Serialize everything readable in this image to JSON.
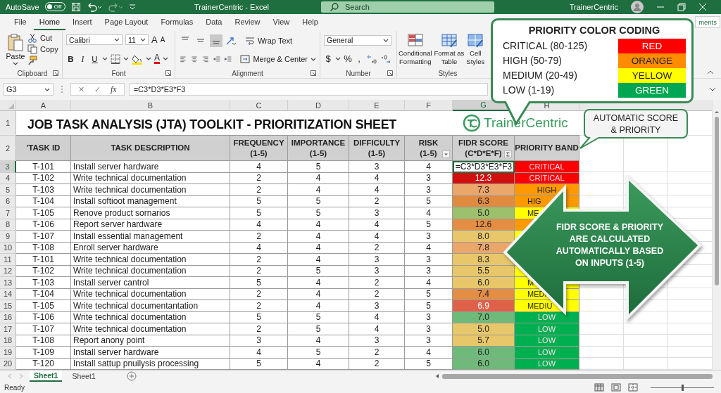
{
  "title_bar": {
    "autosave_label": "AutoSave",
    "autosave": {
      "label": "Off",
      "on": false
    },
    "redo": {
      "disabled": true
    },
    "title": "TrainerCentric - Excel",
    "search": {
      "placeholder": "Search"
    },
    "user": "TrainerCentric"
  },
  "ribbon_tabs": [
    {
      "label": "File",
      "selected": false
    },
    {
      "label": "Home",
      "selected": true
    },
    {
      "label": "Insert",
      "selected": false
    },
    {
      "label": "Page Layout",
      "selected": false
    },
    {
      "label": "Formulas",
      "selected": false
    },
    {
      "label": "Data",
      "selected": false
    },
    {
      "label": "Review",
      "selected": false
    },
    {
      "label": "View",
      "selected": false
    },
    {
      "label": "Help",
      "selected": false
    }
  ],
  "comments_button": "ments",
  "ribbon": {
    "clipboard": {
      "paste": "Paste",
      "cut": "Cut",
      "copy": "Copy",
      "label": "Clipboard"
    },
    "font": {
      "name": "Calibri",
      "size": "11",
      "grow": "A",
      "shrink": "A",
      "format_buttons": [
        "B",
        "I",
        "U"
      ],
      "font_color": "A",
      "label": "Font"
    },
    "alignment": {
      "vertical": [
        {
          "kind": "top",
          "selected": false
        },
        {
          "kind": "middle",
          "selected": false
        },
        {
          "kind": "bottom",
          "selected": true
        }
      ],
      "wrap": "Wrap Text",
      "merge": "Merge & Center",
      "label": "Alignment"
    },
    "number": {
      "format": "General",
      "symbols": [
        "$",
        "%",
        ","
      ],
      "label": "Number"
    },
    "styles": {
      "items": [
        {
          "kind": "conditional",
          "label": "Conditional\nFormatting"
        },
        {
          "kind": "table",
          "label": "Format as\nTable"
        },
        {
          "kind": "cell",
          "label": "Cell\nStyles"
        }
      ],
      "label": "Styles"
    }
  },
  "formula_bar": {
    "name_box": "G3",
    "cancel": "✕",
    "enter": "✓",
    "function": "fx",
    "formula": "=C3*D3*E3*F3"
  },
  "sheet": {
    "columns": [
      {
        "letter": "A",
        "selected": false
      },
      {
        "letter": "B",
        "selected": false
      },
      {
        "letter": "C",
        "selected": false
      },
      {
        "letter": "D",
        "selected": false
      },
      {
        "letter": "E",
        "selected": false
      },
      {
        "letter": "F",
        "selected": false
      },
      {
        "letter": "G",
        "selected": true
      },
      {
        "letter": "H",
        "selected": false
      }
    ],
    "title_row_num": "1",
    "title": "JOB TASK ANALYSIS (JTA) TOOLKIT - PRIORITIZATION SHEET",
    "logo": "TrainerCentric",
    "header_row_num": "2",
    "headers": [
      {
        "label": "'TASK ID",
        "kind": "plain"
      },
      {
        "label": "TASK DESCRIPTION",
        "kind": "plain"
      },
      {
        "label": "FREQUENCY\n(1-5)",
        "kind": "plain"
      },
      {
        "label": "IMPORTANCE\n(1-5)",
        "kind": "plain"
      },
      {
        "label": "DIFFICULTY\n(1-5)",
        "kind": "plain"
      },
      {
        "label": "RISK\n(1-5)",
        "kind": "filter"
      },
      {
        "label": "FIDR SCORE\n(C*D*E*F)",
        "kind": "sum"
      },
      {
        "label": "PRIORITY BAND",
        "kind": "plain"
      }
    ],
    "rows": [
      {
        "num": "3",
        "selected": true,
        "id": "T-101",
        "task": "Install server hardware",
        "values": [
          "4",
          "5",
          "3",
          "4"
        ],
        "score": {
          "text": "=C3*D3*E3*F3",
          "editing": true
        },
        "band": {
          "text": "CRITICAL",
          "color": "#ff0000",
          "cut": false
        }
      },
      {
        "num": "4",
        "selected": false,
        "id": "T-102",
        "task": "Write technical documentation",
        "values": [
          "2",
          "4",
          "4",
          "3"
        ],
        "score": {
          "text": "12.3",
          "color": "#d20f0f",
          "editing": false
        },
        "band": {
          "text": "CRITICAL",
          "color": "#ff0000",
          "cut": false
        }
      },
      {
        "num": "5",
        "selected": false,
        "id": "T-103",
        "task": "Write technical documentation",
        "values": [
          "2",
          "4",
          "4",
          "3"
        ],
        "score": {
          "text": "7.3",
          "color": "#eba66a",
          "editing": false
        },
        "band": {
          "text": "HIGH",
          "color": "#ff9900",
          "cut": false
        }
      },
      {
        "num": "6",
        "selected": false,
        "id": "T-104",
        "task": "Install softioot management",
        "values": [
          "5",
          "5",
          "2",
          "5"
        ],
        "score": {
          "text": "6.3",
          "color": "#e08b3f",
          "editing": false
        },
        "band": {
          "text": "HIG",
          "color": "#ff9900",
          "cut": true
        }
      },
      {
        "num": "7",
        "selected": false,
        "id": "T-105",
        "task": "Renove product sornarios",
        "values": [
          "5",
          "5",
          "3",
          "4"
        ],
        "score": {
          "text": "5.0",
          "color": "#9dc06c",
          "editing": false
        },
        "band": {
          "text": "ME",
          "color": "#ffff00",
          "cut": true
        }
      },
      {
        "num": "8",
        "selected": false,
        "id": "T-106",
        "task": "Report server hardware",
        "values": [
          "4",
          "4",
          "4",
          "5"
        ],
        "score": {
          "text": "12.6",
          "color": "#e48e45",
          "editing": false
        },
        "band": {
          "color": "#ff9900"
        }
      },
      {
        "num": "9",
        "selected": false,
        "id": "T-107",
        "task": "Install essential management",
        "values": [
          "2",
          "4",
          "4",
          "3"
        ],
        "score": {
          "text": "8.0",
          "color": "#e7c76a",
          "editing": false
        },
        "band": {
          "color": "#ffff00"
        }
      },
      {
        "num": "10",
        "selected": false,
        "id": "T-108",
        "task": "Enroll server hardware",
        "values": [
          "4",
          "4",
          "2",
          "4"
        ],
        "score": {
          "text": "7.8",
          "color": "#eba66a",
          "editing": false
        }
      },
      {
        "num": "11",
        "selected": false,
        "id": "T-101",
        "task": "Write technical documentation",
        "values": [
          "2",
          "4",
          "3",
          "3"
        ],
        "score": {
          "text": "8.3",
          "color": "#e7c76a",
          "editing": false
        }
      },
      {
        "num": "12",
        "selected": false,
        "id": "T-102",
        "task": "Write technical documentation",
        "values": [
          "2",
          "5",
          "3",
          "3"
        ],
        "score": {
          "text": "5.5",
          "color": "#e7c76a",
          "editing": false
        },
        "band": {
          "color": "#ffff00"
        }
      },
      {
        "num": "13",
        "selected": false,
        "id": "T-103",
        "task": "Install server cantrol",
        "values": [
          "5",
          "4",
          "2",
          "4"
        ],
        "score": {
          "text": "6.0",
          "color": "#e7c76a",
          "editing": false
        },
        "band": {
          "text": "M",
          "color": "#ffff00",
          "cut": true
        }
      },
      {
        "num": "14",
        "selected": false,
        "id": "T-104",
        "task": "Write technical documentation",
        "values": [
          "2",
          "4",
          "2",
          "5"
        ],
        "score": {
          "text": "7.4",
          "color": "#e48e45",
          "editing": false
        },
        "band": {
          "text": "MEDI",
          "color": "#ffff00",
          "cut": true
        }
      },
      {
        "num": "15",
        "selected": false,
        "id": "T-105",
        "task": "Write technical documentantation",
        "values": [
          "2",
          "4",
          "3",
          "5"
        ],
        "score": {
          "text": "6.9",
          "color": "#e0614a",
          "editing": false
        },
        "band": {
          "text": "MEDIU",
          "color": "#ffff00",
          "cut": true
        }
      },
      {
        "num": "16",
        "selected": false,
        "id": "T-106",
        "task": "Write technical documentation",
        "values": [
          "5",
          "5",
          "4",
          "3"
        ],
        "score": {
          "text": "7.0",
          "color": "#6fba7a",
          "editing": false
        },
        "band": {
          "text": "LOW",
          "color": "#00b050",
          "cut": false
        }
      },
      {
        "num": "17",
        "selected": false,
        "id": "T-107",
        "task": "Write technical documentation",
        "values": [
          "2",
          "5",
          "4",
          "3"
        ],
        "score": {
          "text": "5.0",
          "color": "#e7c76a",
          "editing": false
        },
        "band": {
          "text": "LOW",
          "color": "#00b050",
          "cut": false
        }
      },
      {
        "num": "18",
        "selected": false,
        "id": "T-108",
        "task": "Report anony point",
        "values": [
          "3",
          "4",
          "3",
          "3"
        ],
        "score": {
          "text": "5.7",
          "color": "#e7c76a",
          "editing": false
        },
        "band": {
          "text": "LOW",
          "color": "#00b050",
          "cut": false
        }
      },
      {
        "num": "19",
        "selected": false,
        "id": "T-109",
        "task": "Install server hardware",
        "values": [
          "4",
          "5",
          "2",
          "4"
        ],
        "score": {
          "text": "6.0",
          "color": "#6fba7a",
          "editing": false
        },
        "band": {
          "text": "LOW",
          "color": "#00b050",
          "cut": false
        }
      },
      {
        "num": "20",
        "selected": false,
        "id": "T-120",
        "task": "Install sattup pnuilysis processing",
        "values": [
          "5",
          "4",
          "2",
          "5"
        ],
        "score": {
          "text": "6.0",
          "color": "#6fba7a",
          "editing": false
        },
        "band": {
          "text": "LOW",
          "color": "#00b050",
          "cut": false
        }
      }
    ]
  },
  "sheet_tabs": [
    {
      "label": "Sheet1",
      "selected": true
    },
    {
      "label": "Sheet1",
      "selected": false
    }
  ],
  "status_bar": {
    "text": "Ready",
    "zoom": {
      "level": 0.5
    }
  },
  "legend_callout": {
    "title": "PRIORITY COLOR CODING",
    "items": [
      {
        "label": "CRITICAL (80-125)",
        "swatch": "RED",
        "color": "#ff0000"
      },
      {
        "label": "HIGH (50-79)",
        "swatch": "ORANGE",
        "color": "#ff8c00"
      },
      {
        "label": "MEDIUM (20-49)",
        "swatch": "YELLOW",
        "color": "#ffff00"
      },
      {
        "label": "LOW (1-19)",
        "swatch": "GREEN",
        "color": "#00a651"
      }
    ]
  },
  "note_callout": {
    "text": "AUTOMATIC SCORE\n& PRIORITY"
  },
  "arrow_callout": {
    "text": "FIDR SCORE & PRIORITY\nARE CALCULATED\nAUTOMATICALLY BASED\nON INPUTS (1-5)"
  }
}
